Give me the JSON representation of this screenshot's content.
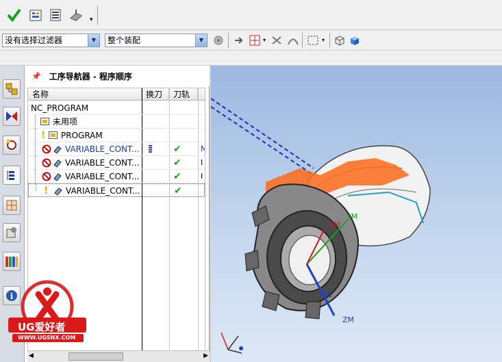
{
  "toolbar": {
    "icons": [
      "check-icon",
      "operation-icon",
      "program-icon",
      "machine-icon"
    ]
  },
  "filters": {
    "selection_filter": "没有选择过滤器",
    "assembly_scope": "整个装配"
  },
  "navigator": {
    "title": "工序导航器 - 程序顺序",
    "columns": [
      "名称",
      "换刀",
      "刀轨",
      ""
    ],
    "rows": [
      {
        "name": "NC_PROGRAM"
      },
      {
        "name": "未用项"
      },
      {
        "name": "PROGRAM"
      },
      {
        "name": "VARIABLE_CONT..."
      },
      {
        "name": "VARIABLE_CONT..."
      },
      {
        "name": "VARIABLE_CONT..."
      },
      {
        "name": "VARIABLE_CONT..."
      }
    ]
  },
  "viewport": {
    "axis_labels": [
      "XM",
      "YM",
      "ZM",
      "ZC"
    ]
  },
  "watermark": {
    "brand": "UG爱好者",
    "url": "WWW.UGSNX.COM"
  },
  "colors": {
    "check_green": "#1aa01a",
    "toolpath_orange": "#ff6a1a",
    "link_blue": "#1a3ca0",
    "watermark_red": "#d9191a"
  }
}
